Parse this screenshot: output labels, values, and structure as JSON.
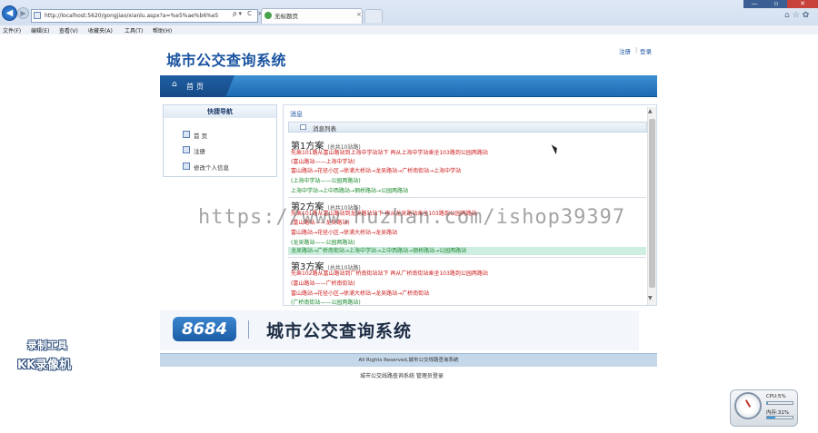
{
  "browser": {
    "url": "http://localhost:5620/gongjiao/xianlu.aspx?a=%e5%ae%b6%e5",
    "tab_title": "无标题页",
    "tab_close": "×",
    "addr_tools": "ρ▾ C ×",
    "right_icons": "⌂☆✿",
    "win_min": "—",
    "win_max": "▫",
    "win_close": "✕",
    "menu": [
      "文件(F)",
      "编辑(E)",
      "查看(V)",
      "收藏夹(A)",
      "工具(T)",
      "帮助(H)"
    ]
  },
  "site": {
    "title": "城市公交查询系统",
    "register": "注册",
    "login": "登录",
    "nav_home": "首页",
    "home_glyph": "⌂"
  },
  "sidebar": {
    "heading": "快捷导航",
    "items": [
      "首  页",
      "注册",
      "修改个人信息"
    ]
  },
  "content": {
    "title": "消息",
    "list_label": "消息列表",
    "scroll_up": "▲",
    "scroll_down": "▼",
    "plans": [
      {
        "title": "第1方案",
        "count": "(总共10站路)",
        "lines": [
          {
            "text": "先乘101路从富山路站到上海中学站站下 再从上海中学站乘坐103路到公园两路站",
            "color": "red"
          },
          {
            "text": "(富山路站——上海中学站)",
            "color": "red"
          },
          {
            "text": "富山路站→花径小区→徐浦大桥站→龙吴路站→广桥南街站→上海中学站",
            "color": "red"
          },
          {
            "text": "(上海中学站——公园两路站)",
            "color": "green"
          },
          {
            "text": "上海中学站→上中西路站→钢桥路站→公园两路站",
            "color": "green"
          }
        ]
      },
      {
        "title": "第2方案",
        "count": "(总共10站路)",
        "lines": [
          {
            "text": "先乘101路从富山路站到龙吴路站站下 再从龙吴路站乘坐103路到公园两路站",
            "color": "red"
          },
          {
            "text": "(富山路站——龙吴路站)",
            "color": "red"
          },
          {
            "text": "富山路站→花径小区→徐浦大桥站→龙吴路站",
            "color": "red"
          },
          {
            "text": "(龙吴路站——公园两路站)",
            "color": "green"
          },
          {
            "text": "龙吴路站→广桥南街站→上海中学站→上中西路站→钢桥路站→公园两路站",
            "color": "green"
          }
        ]
      },
      {
        "title": "第3方案",
        "count": "(总共10站路)",
        "lines": [
          {
            "text": "先乘102路从富山路站到广桥南街站站下 再从广桥南街站乘坐103路到公园两路站",
            "color": "red"
          },
          {
            "text": "(富山路站——广桥南街站)",
            "color": "red"
          },
          {
            "text": "富山路站→花径小区→徐浦大桥站→龙吴路站→广桥南街站",
            "color": "red"
          },
          {
            "text": "(广桥南街站——公园两路站)",
            "color": "green"
          }
        ]
      }
    ]
  },
  "footer": {
    "logo": "8684",
    "banner_title": "城市公交查询系统",
    "copyright": "All Rights Reserved,城市公交线路查询系统",
    "links": "城市公交线路查询系统 管理员登录"
  },
  "overlays": {
    "watermark": "https://www.huzhan.com/ishop39397",
    "recorder_line1": "录制工具",
    "recorder_line2": "KK录像机"
  },
  "gadget": {
    "cpu": "CPU:5%",
    "mem": "内存:31%",
    "cpu_level": 0.05,
    "mem_level": 0.31
  }
}
